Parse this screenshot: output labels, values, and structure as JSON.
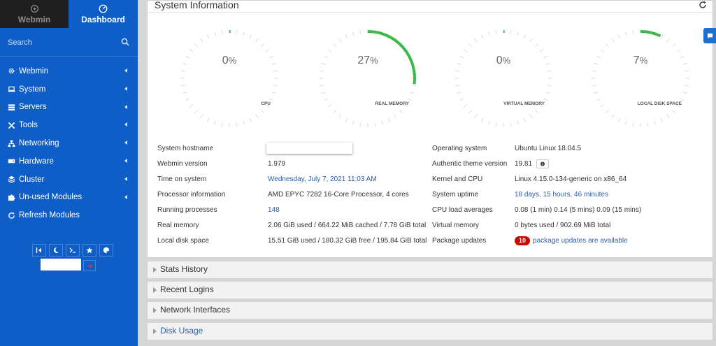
{
  "sidebar": {
    "tabs": {
      "webmin": "Webmin",
      "dashboard": "Dashboard"
    },
    "search_placeholder": "Search",
    "items": [
      {
        "label": "Webmin",
        "icon": "gear-icon"
      },
      {
        "label": "System",
        "icon": "laptop-icon"
      },
      {
        "label": "Servers",
        "icon": "server-icon"
      },
      {
        "label": "Tools",
        "icon": "tools-icon"
      },
      {
        "label": "Networking",
        "icon": "network-icon"
      },
      {
        "label": "Hardware",
        "icon": "hdd-icon"
      },
      {
        "label": "Cluster",
        "icon": "layers-icon"
      },
      {
        "label": "Un-used Modules",
        "icon": "puzzle-icon"
      },
      {
        "label": "Refresh Modules",
        "icon": "refresh-icon"
      }
    ]
  },
  "panel": {
    "title": "System Information",
    "gauges": [
      {
        "label": "CPU",
        "value": "0",
        "unit": "%",
        "fraction": 0.0
      },
      {
        "label": "REAL MEMORY",
        "value": "27",
        "unit": "%",
        "fraction": 0.27
      },
      {
        "label": "VIRTUAL MEMORY",
        "value": "0",
        "unit": "%",
        "fraction": 0.0
      },
      {
        "label": "LOCAL DISK SPACE",
        "value": "7",
        "unit": "%",
        "fraction": 0.07
      }
    ],
    "left_info": [
      {
        "key": "System hostname",
        "value": ""
      },
      {
        "key": "Webmin version",
        "value": "1.979"
      },
      {
        "key": "Time on system",
        "value": "Wednesday, July 7, 2021 11:03 AM",
        "link": true
      },
      {
        "key": "Processor information",
        "value": "AMD EPYC 7282 16-Core Processor, 4 cores"
      },
      {
        "key": "Running processes",
        "value": "148",
        "link": true
      },
      {
        "key": "Real memory",
        "value": "2.06 GiB used / 664.22 MiB cached / 7.78 GiB total"
      },
      {
        "key": "Local disk space",
        "value": "15.51 GiB used / 180.32 GiB free / 195.84 GiB total"
      }
    ],
    "right_info": [
      {
        "key": "Operating system",
        "value": "Ubuntu Linux 18.04.5"
      },
      {
        "key": "Authentic theme version",
        "value": "19.81"
      },
      {
        "key": "Kernel and CPU",
        "value": "Linux 4.15.0-134-generic on x86_64"
      },
      {
        "key": "System uptime",
        "value": "18 days, 15 hours, 46 minutes",
        "link": true
      },
      {
        "key": "CPU load averages",
        "value": "0.08 (1 min) 0.14 (5 mins) 0.09 (15 mins)"
      },
      {
        "key": "Virtual memory",
        "value": "0 bytes used / 902.69 MiB total"
      },
      {
        "key": "Package updates",
        "badge": "10",
        "value": "package updates are available",
        "link": true
      }
    ]
  },
  "sections": [
    {
      "title": "Stats History"
    },
    {
      "title": "Recent Logins"
    },
    {
      "title": "Network Interfaces"
    },
    {
      "title": "Disk Usage"
    }
  ],
  "colors": {
    "sidebar": "#0f5ec8",
    "gauge_fill": "#3db84a",
    "link": "#2a5ea8",
    "badge": "#d40000"
  }
}
